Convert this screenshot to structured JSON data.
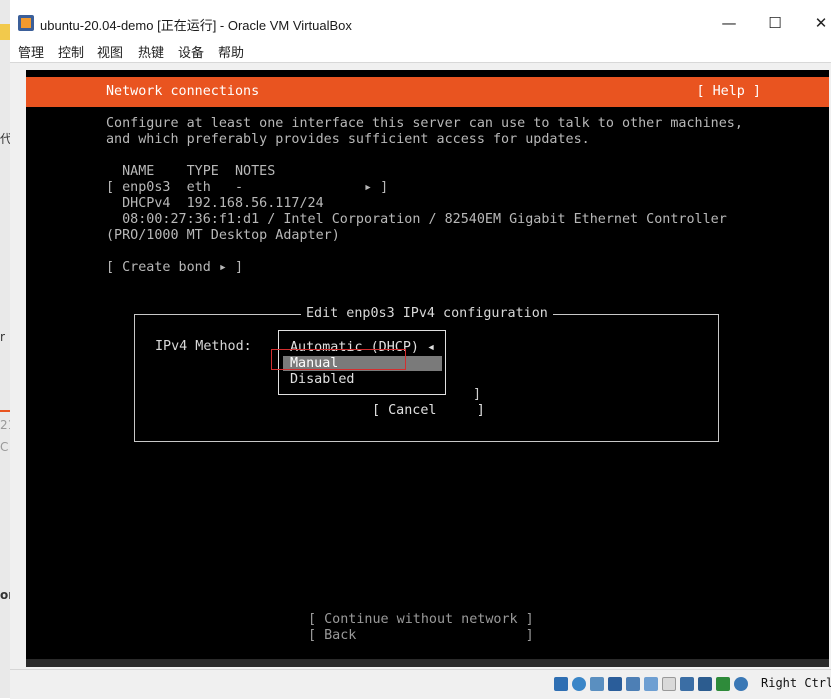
{
  "window": {
    "title": "ubuntu-20.04-demo [正在运行] - Oracle VM VirtualBox",
    "minimize": "—",
    "maximize": "☐",
    "close": "✕"
  },
  "menu": {
    "items": [
      "管理",
      "控制",
      "视图",
      "热键",
      "设备",
      "帮助"
    ]
  },
  "background_fragments": {
    "a": "代",
    "b": "r",
    "c": "21",
    "d": "C",
    "e": "or"
  },
  "installer": {
    "header_title": "Network connections",
    "help": "[ Help ]",
    "intro_line1": "Configure at least one interface this server can use to talk to other machines,",
    "intro_line2": "and which preferably provides sufficient access for updates.",
    "table_header": "  NAME    TYPE  NOTES",
    "iface_row": "[ enp0s3  eth   -               ▸ ]",
    "dhcp_row": "  DHCPv4  192.168.56.117/24",
    "mac_row": "  08:00:27:36:f1:d1 / Intel Corporation / 82540EM Gigabit Ethernet Controller",
    "adapter_row": "(PRO/1000 MT Desktop Adapter)",
    "create_bond": "[ Create bond ▸ ]",
    "continue": "[ Continue without network ]",
    "back": "[ Back                     ]"
  },
  "dialog": {
    "title": "Edit enp0s3 IPv4 configuration",
    "method_label": "IPv4 Method:",
    "options": [
      "Automatic (DHCP) ◂",
      "Manual",
      "Disabled"
    ],
    "selected_option": "Manual",
    "ok_bracket": "]",
    "cancel": "[ Cancel     ]",
    "cancel_bracket": "]"
  },
  "statusbar": {
    "host_key": "Right Ctrl",
    "icons": [
      "hdd-icon",
      "optical-icon",
      "audio-icon",
      "network-icon",
      "usb-icon",
      "shared-folder-icon",
      "display-icon",
      "recording-icon",
      "cpu-icon",
      "mouse-integration-icon",
      "keyboard-icon"
    ]
  },
  "colors": {
    "ubuntu_orange": "#e95420",
    "terminal_bg": "#000000",
    "highlight": "#7a7a7a",
    "annotation_red": "#d32f2f"
  }
}
